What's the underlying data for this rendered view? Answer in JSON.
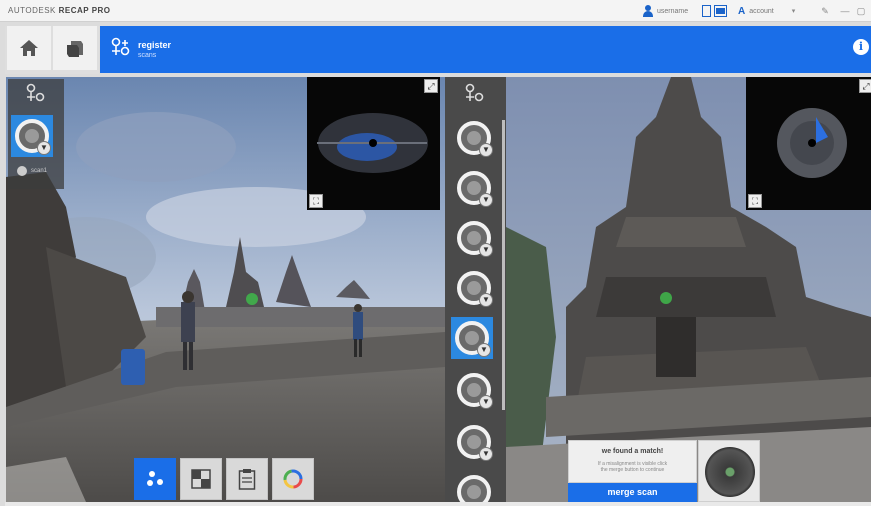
{
  "titlebar": {
    "app_name": "AUTODESK",
    "app_product": "RECAP PRO",
    "user_name": "username",
    "account_label": "account"
  },
  "header": {
    "title": "register",
    "subtitle": "scans"
  },
  "left_pane": {
    "thumb_caption": "scan1"
  },
  "match_panel": {
    "title": "we found a match!",
    "description_line1": "If a misalignment is visible click",
    "description_line2": "the merge button to continue",
    "merge_button_label": "merge scan"
  },
  "colors": {
    "accent": "#1a6ee8",
    "selected_thumb": "#2c89e0",
    "toolbar_bg": "#d9d9d9"
  },
  "icons": {
    "home": "home-icon",
    "layers": "layers-icon",
    "register": "register-icon",
    "info": "info-icon",
    "filter": "filter-icon",
    "expand": "expand-icon",
    "fullscreen": "fullscreen-icon"
  }
}
